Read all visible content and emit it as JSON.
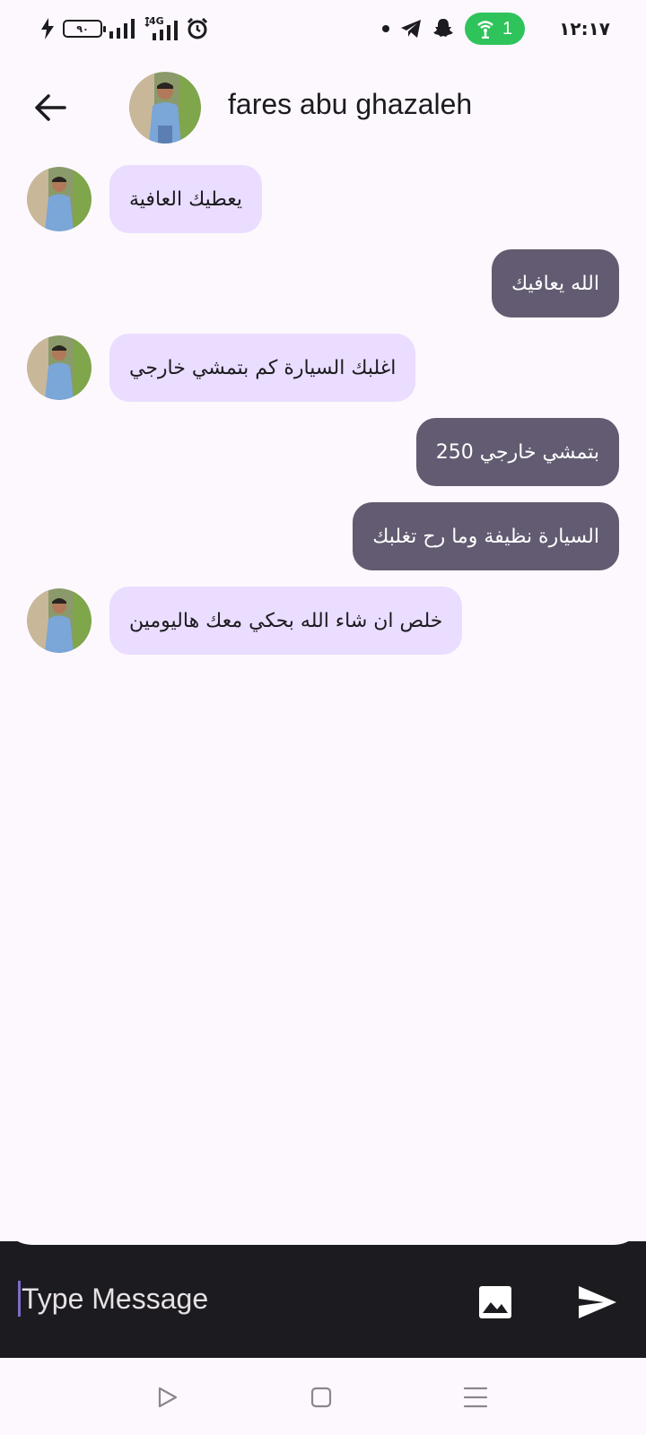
{
  "status_bar": {
    "time": "١٢:١٧",
    "battery_level": "٩٠",
    "network_type": "4G",
    "hotspot_count": "1",
    "icons": [
      "charging-icon",
      "battery-icon",
      "signal-icon",
      "signal-4g-icon",
      "alarm-icon",
      "dot-icon",
      "telegram-icon",
      "snapchat-icon",
      "hotspot-icon"
    ]
  },
  "header": {
    "contact_name": "fares abu ghazaleh",
    "back_icon": "arrow-left-icon",
    "avatar_icon": "contact-avatar"
  },
  "messages": [
    {
      "direction": "incoming",
      "text": "يعطيك العافية"
    },
    {
      "direction": "outgoing",
      "text": "الله يعافيك"
    },
    {
      "direction": "incoming",
      "text": "اغلبك السيارة كم بتمشي خارجي"
    },
    {
      "direction": "outgoing",
      "text": "بتمشي خارجي 250"
    },
    {
      "direction": "outgoing",
      "text": "السيارة نظيفة وما رح تغلبك"
    },
    {
      "direction": "incoming",
      "text": "خلص ان شاء الله بحكي معك هاليومين"
    }
  ],
  "composer": {
    "placeholder": "Type Message",
    "value": "",
    "image_icon": "image-icon",
    "send_icon": "send-icon"
  },
  "nav_bar": {
    "icons": [
      "back-triangle-icon",
      "home-square-icon",
      "recents-menu-icon"
    ]
  },
  "colors": {
    "background": "#fdf8fd",
    "incoming_bubble": "#eaddff",
    "outgoing_bubble": "#625b71",
    "input_bar": "#1c1b1f",
    "hotspot_pill": "#2fc35b",
    "caret": "#7e6bc9"
  }
}
